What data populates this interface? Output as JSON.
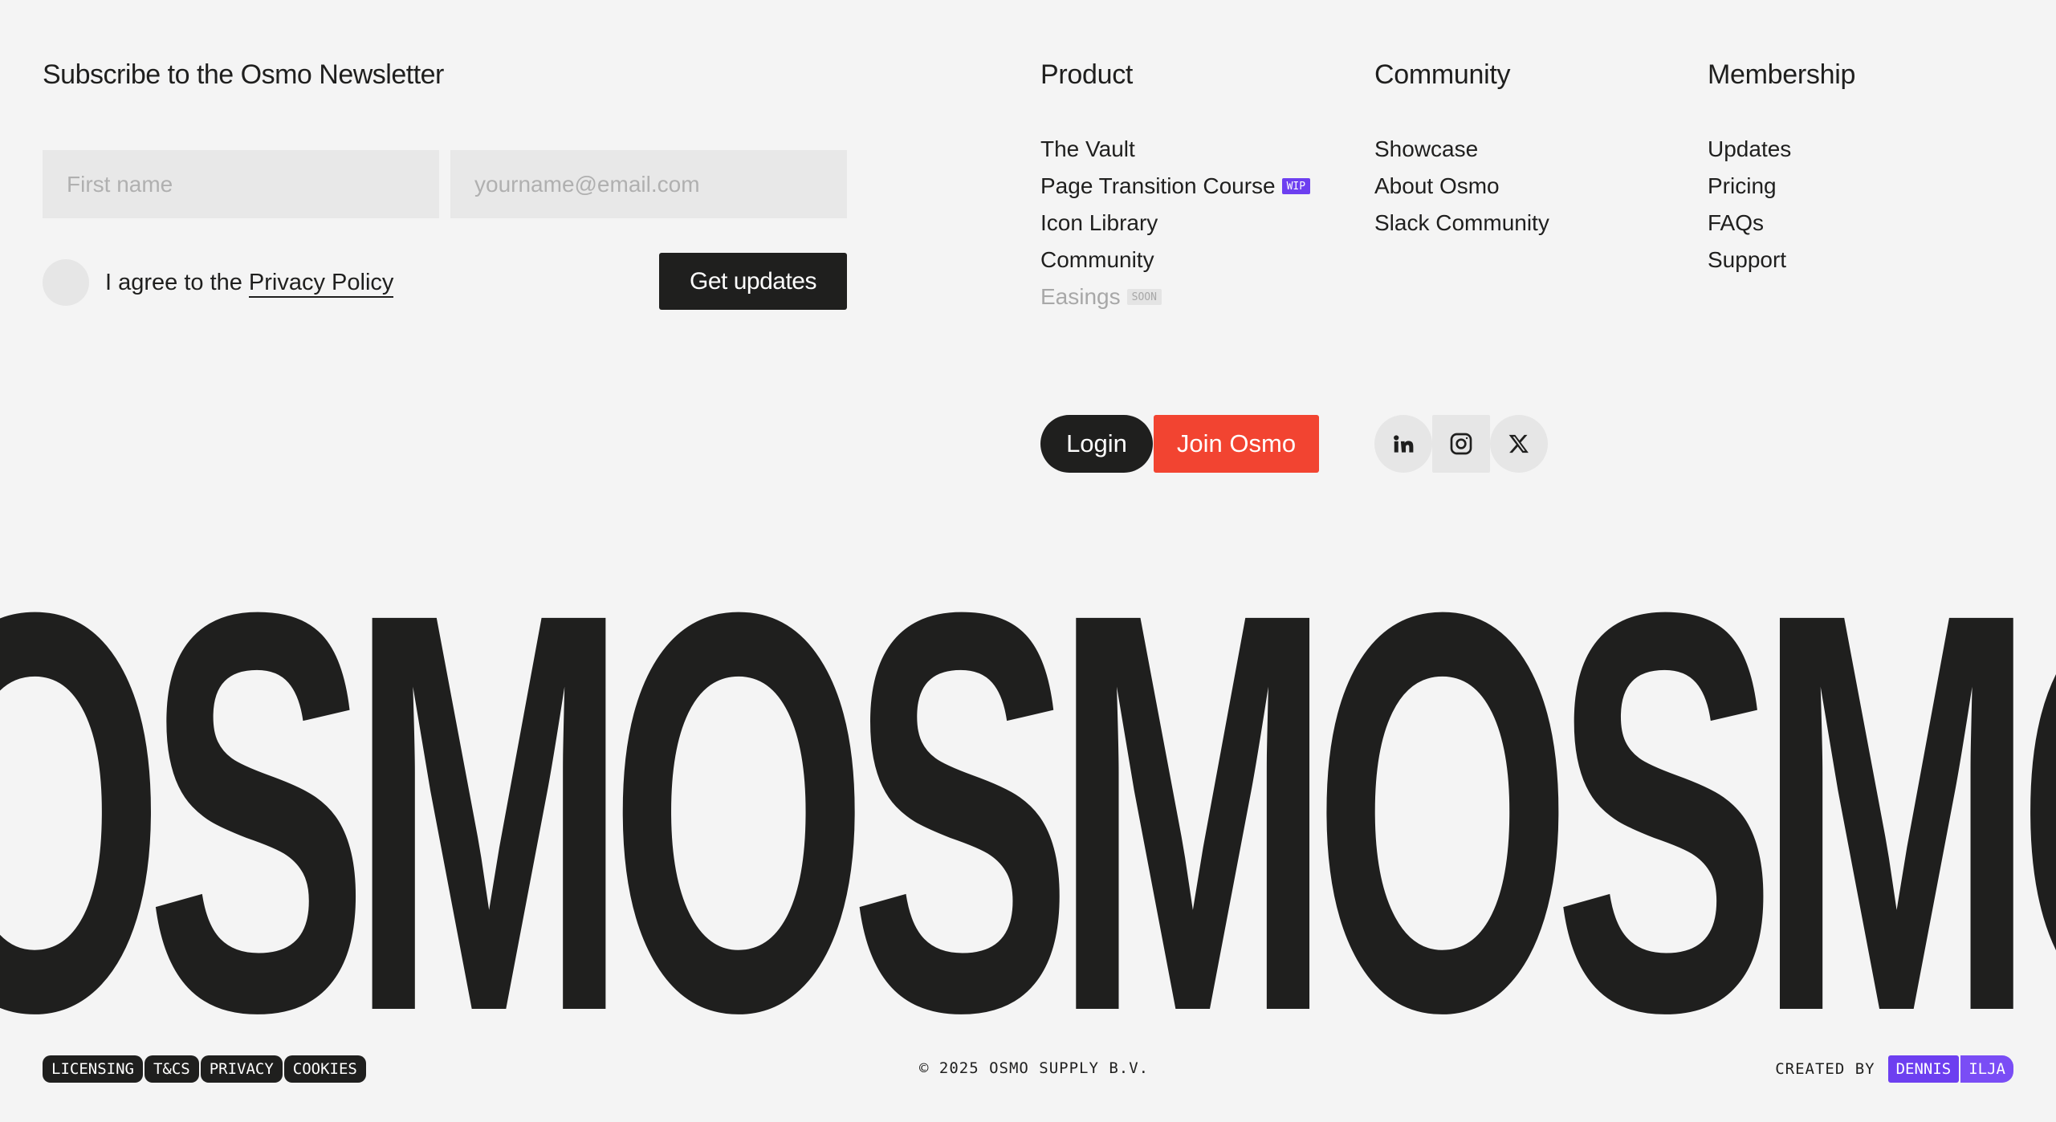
{
  "newsletter": {
    "title": "Subscribe to the Osmo Newsletter",
    "first_name_placeholder": "First name",
    "email_placeholder": "yourname@email.com",
    "agree_text": "I agree to the",
    "privacy_link": "Privacy Policy",
    "submit_label": "Get updates"
  },
  "columns": {
    "product": {
      "title": "Product",
      "items": [
        {
          "label": "The Vault"
        },
        {
          "label": "Page Transition Course",
          "tag": "WIP"
        },
        {
          "label": "Icon Library"
        },
        {
          "label": "Community"
        },
        {
          "label": "Easings",
          "tag": "SOON"
        }
      ]
    },
    "community": {
      "title": "Community",
      "items": [
        {
          "label": "Showcase"
        },
        {
          "label": "About Osmo"
        },
        {
          "label": "Slack Community"
        }
      ]
    },
    "membership": {
      "title": "Membership",
      "items": [
        {
          "label": "Updates"
        },
        {
          "label": "Pricing"
        },
        {
          "label": "FAQs"
        },
        {
          "label": "Support"
        }
      ]
    }
  },
  "auth": {
    "login_label": "Login",
    "join_label": "Join Osmo"
  },
  "social": {
    "linkedin_icon": "linkedin-icon",
    "instagram_icon": "instagram-icon",
    "x_icon": "x-icon"
  },
  "wordmark": {
    "text": "OSMOSMOSMO"
  },
  "footer": {
    "legal_links": [
      "LICENSING",
      "T&CS",
      "PRIVACY",
      "COOKIES"
    ],
    "copyright": "© 2025 OSMO SUPPLY B.V.",
    "created_by_label": "CREATED BY",
    "creators": [
      "DENNIS",
      "ILJA"
    ]
  },
  "colors": {
    "background": "#f4f4f4",
    "ink": "#1f1f1e",
    "accent_red": "#f24431",
    "accent_purple": "#6d3ff0"
  }
}
